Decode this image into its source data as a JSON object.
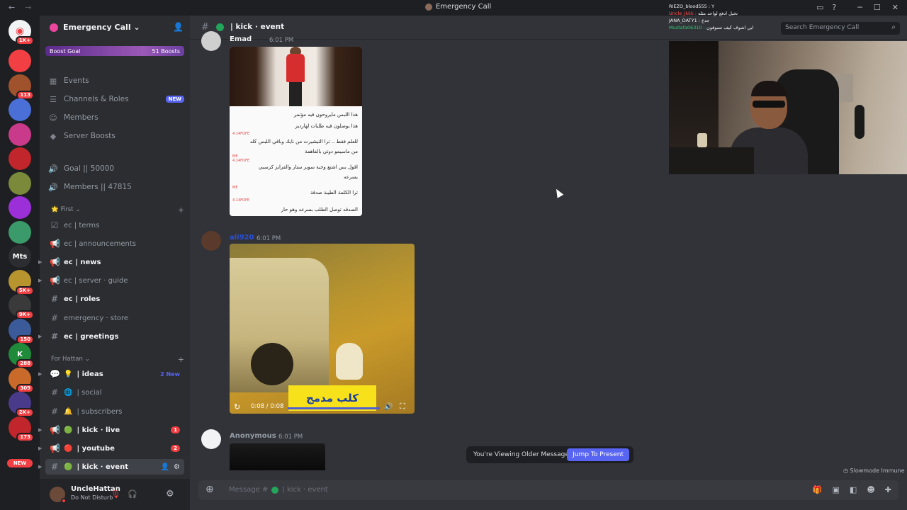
{
  "window": {
    "title": "Emergency Call",
    "nav_back": "←",
    "nav_fwd": "→",
    "min": "─",
    "max": "☐",
    "close": "✕",
    "inbox_icon": "▭",
    "help_icon": "?"
  },
  "rail": {
    "home_badge": "1K+",
    "servers": [
      {
        "label": "",
        "color": "#f23f43",
        "badge": ""
      },
      {
        "label": "",
        "color": "#a0522d",
        "badge": "113"
      },
      {
        "label": "",
        "color": "#4a6fd6",
        "badge": ""
      },
      {
        "label": "",
        "color": "#c93b8a",
        "badge": ""
      },
      {
        "label": "",
        "color": "#c0262b",
        "badge": ""
      },
      {
        "label": "",
        "color": "#7a8a3a",
        "badge": ""
      },
      {
        "label": "",
        "color": "#9b30d9",
        "badge": ""
      },
      {
        "label": "",
        "color": "#3a9a6a",
        "badge": ""
      },
      {
        "label": "Mts",
        "color": "#2b2d31",
        "badge": ""
      },
      {
        "label": "",
        "color": "#b8942e",
        "badge": "5K+"
      },
      {
        "label": "",
        "color": "#3a3a3a",
        "badge": "9K+"
      },
      {
        "label": "",
        "color": "#3a5a9a",
        "badge": "150"
      },
      {
        "label": "K",
        "color": "#1e8a3a",
        "badge": "288"
      },
      {
        "label": "",
        "color": "#c96a2a",
        "badge": "309"
      },
      {
        "label": "",
        "color": "#4a3a8a",
        "badge": "2K+"
      },
      {
        "label": "",
        "color": "#c0262b",
        "badge": "173"
      }
    ],
    "new_label": "NEW"
  },
  "sidebar": {
    "server_name": "Emergency Call",
    "server_caret": "⌄",
    "boost_goal": "Boost Goal",
    "boosts": "51 Boosts",
    "nav": [
      {
        "label": "Events",
        "icon": "▦"
      },
      {
        "label": "Channels & Roles",
        "icon": "☰",
        "badge": "NEW"
      },
      {
        "label": "Members",
        "icon": "☺"
      },
      {
        "label": "Server Boosts",
        "icon": "◆"
      }
    ],
    "stats": [
      {
        "label": "Goal || 50000"
      },
      {
        "label": "Members || 47815"
      }
    ],
    "categories": [
      {
        "label": "First",
        "emoji": "🌟"
      },
      {
        "label": "For Hattan",
        "emoji": ""
      }
    ],
    "channels": [
      {
        "label": "ec | terms",
        "icon": "☑"
      },
      {
        "label": "ec | announcements",
        "icon": "📢"
      },
      {
        "label": "ec | news",
        "icon": "📢"
      },
      {
        "label": "ec | server · guide",
        "icon": "📢"
      },
      {
        "label": "ec | roles",
        "icon": "#"
      },
      {
        "label": "emergency · store",
        "icon": "#"
      },
      {
        "label": "ec | greetings",
        "icon": "#"
      },
      {
        "label": "| ideas",
        "icon": "💬",
        "emoji": "💡",
        "extra": "2 New"
      },
      {
        "label": "| social",
        "icon": "#",
        "emoji": "🌐"
      },
      {
        "label": "| subscribers",
        "icon": "#",
        "emoji": "🔔"
      },
      {
        "label": "| kick · live",
        "icon": "📢",
        "emoji": "🟢",
        "count": "1"
      },
      {
        "label": "| youtube",
        "icon": "📢",
        "emoji": "🔴",
        "count": "2"
      },
      {
        "label": "| kick · event",
        "icon": "#",
        "emoji": "🟢"
      }
    ]
  },
  "user": {
    "name": "UncleHattan",
    "status": "Do Not Disturb"
  },
  "header": {
    "channel": "| kick · event",
    "search_placeholder": "Search Emergency Call"
  },
  "stream_chat": [
    {
      "user": "RIEZO_blood555 :",
      "text": "Y"
    },
    {
      "user": "Uncle_Jkkk :",
      "text": "تخيل ادفع لواحد مثله"
    },
    {
      "user": "JANA_DATY1 :",
      "text": "جدع"
    },
    {
      "user": "Mustafa06310 :",
      "text": "ابي اشوف كيف تسوقون"
    }
  ],
  "messages": [
    {
      "author": "Emad",
      "time": "6:01 PM",
      "image_lines": [
        "هذا اللبس مايروحون فيه مؤتمر",
        "هذا يوصلون فيه طلبات لهارديز",
        "للعلم فقط .. ترا التيشيرت من نايك وباقي اللبس كله",
        "من ماسيمو دوتي بالفاهمة",
        "اقول بس اشتغ وجبة سوبر ستار والفرايز كرسبي",
        "بسرعه",
        "ترا الكلمة الطيبة صدقة",
        "الصدقه توصل الطلب بسرعه وهو حار"
      ],
      "image_tags": [
        "4.14FOFE",
        "ME",
        "4.14FOFE",
        "ME",
        "4.14FOFE"
      ]
    },
    {
      "author": "ali920",
      "time": "6:01 PM",
      "video_caption": "كلب مدمج",
      "video_time": "0:08 / 0:08"
    },
    {
      "author": "Anonymous",
      "time": "6:01 PM"
    }
  ],
  "older_bar": {
    "text": "You're Viewing Older Messages",
    "button": "Jump To Present"
  },
  "slowmode": "Slowmode Immune",
  "composer": {
    "placeholder_prefix": "Message #",
    "placeholder_channel": "| kick · event"
  }
}
